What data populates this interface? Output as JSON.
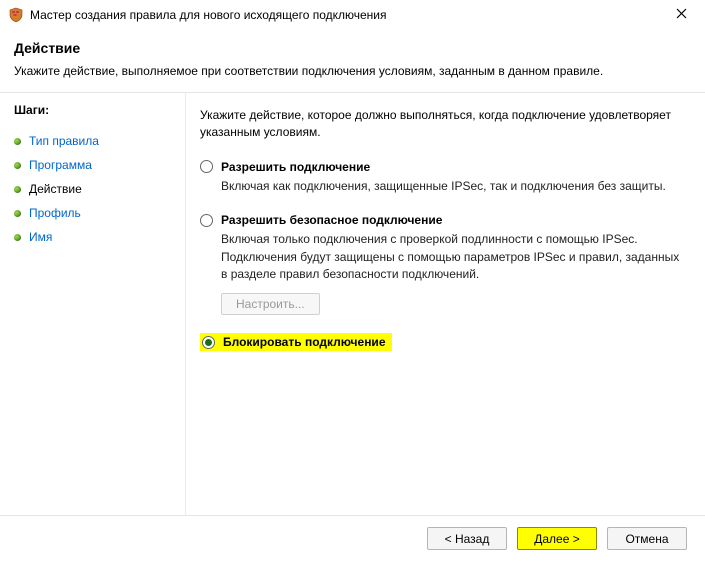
{
  "titlebar": {
    "title": "Мастер создания правила для нового исходящего подключения"
  },
  "header": {
    "title": "Действие",
    "subtitle": "Укажите действие, выполняемое при соответствии подключения условиям, заданным в данном правиле."
  },
  "sidebar": {
    "steps_title": "Шаги:",
    "items": [
      {
        "label": "Тип правила",
        "current": false
      },
      {
        "label": "Программа",
        "current": false
      },
      {
        "label": "Действие",
        "current": true
      },
      {
        "label": "Профиль",
        "current": false
      },
      {
        "label": "Имя",
        "current": false
      }
    ]
  },
  "content": {
    "intro": "Укажите действие, которое должно выполняться, когда подключение удовлетворяет указанным условиям.",
    "options": {
      "allow": {
        "label": "Разрешить подключение",
        "desc": "Включая как подключения, защищенные IPSec, так и подключения без защиты.",
        "selected": false
      },
      "allow_secure": {
        "label": "Разрешить безопасное подключение",
        "desc": "Включая только подключения с проверкой подлинности с помощью IPSec. Подключения будут защищены с помощью параметров IPSec и правил, заданных в разделе правил безопасности подключений.",
        "configure_btn": "Настроить...",
        "selected": false
      },
      "block": {
        "label": "Блокировать подключение",
        "selected": true
      }
    }
  },
  "footer": {
    "back": "< Назад",
    "next": "Далее >",
    "cancel": "Отмена"
  }
}
